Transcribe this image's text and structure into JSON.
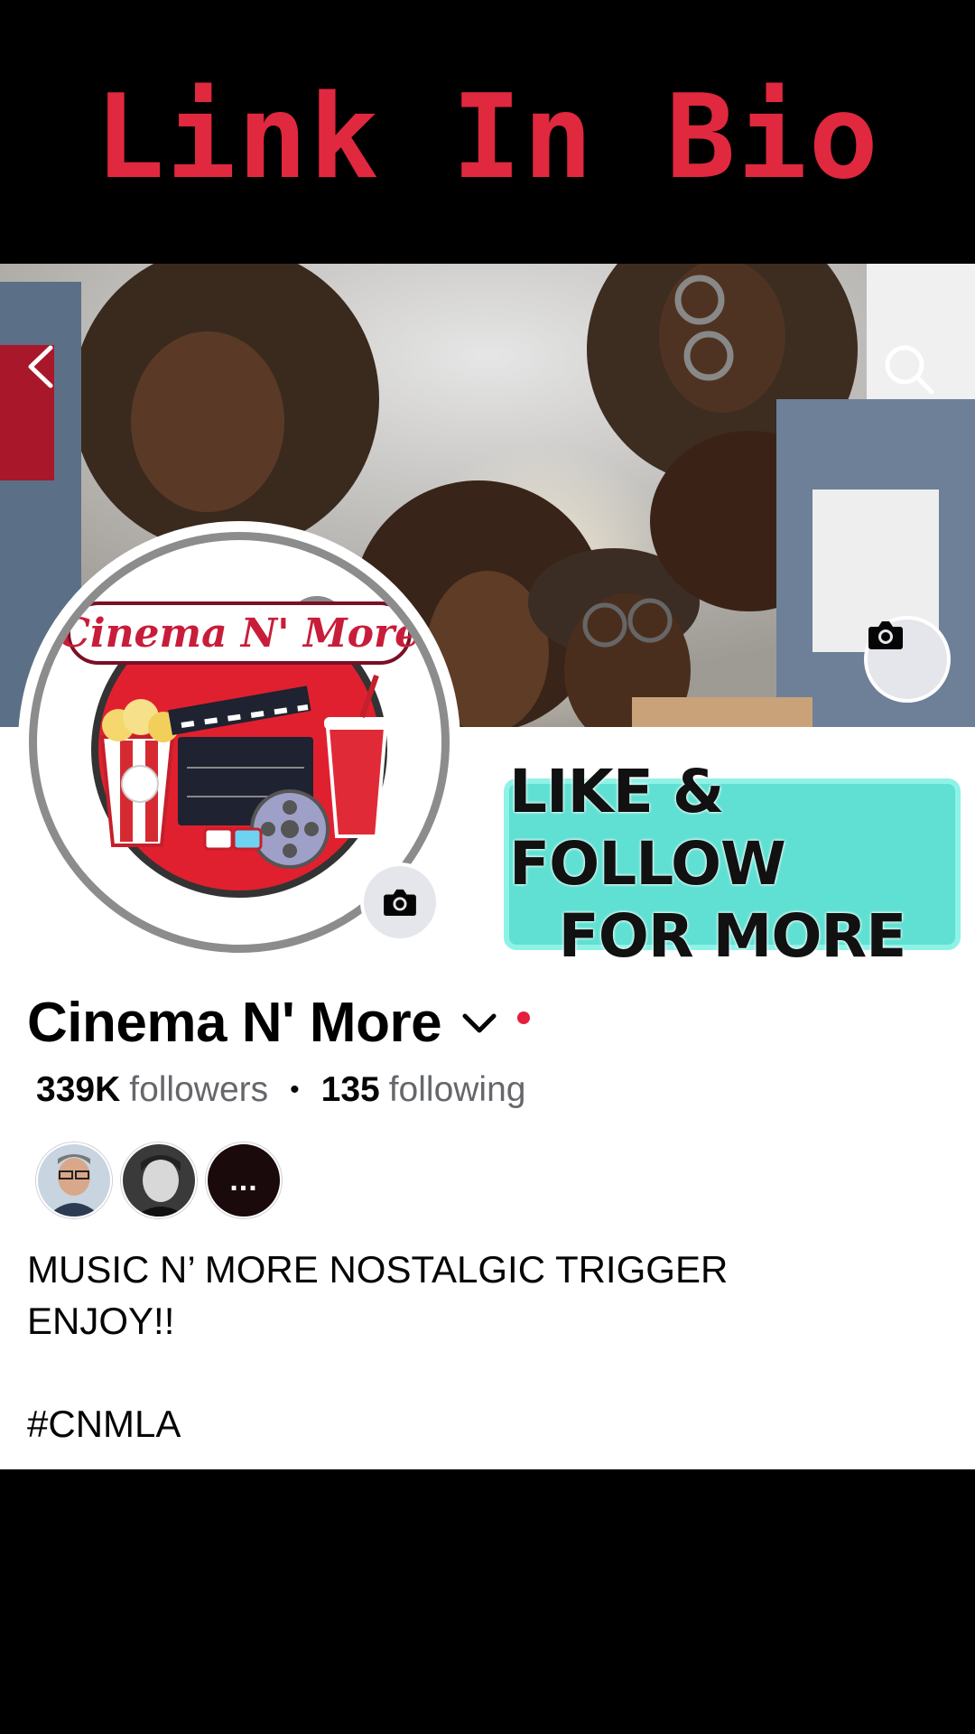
{
  "banner": {
    "title": "Link In Bio"
  },
  "header": {
    "back_icon": "chevron-left-icon",
    "search_icon": "search-icon"
  },
  "profile": {
    "name": "Cinema N' More",
    "logo_text": "Cinema N' More",
    "followers_count": "339K",
    "followers_label": "followers",
    "following_count": "135",
    "following_label": "following",
    "separator": "•"
  },
  "promo": {
    "line1": "LIKE & FOLLOW",
    "line2": "FOR MORE"
  },
  "friends": {
    "more_label": "..."
  },
  "bio": {
    "line1": "MUSIC N’ MORE NOSTALGIC TRIGGER",
    "line2": "ENJOY!!",
    "hashtag": "#CNMLA"
  },
  "colors": {
    "banner_text": "#e0283f",
    "promo_bg": "#5fe0d2",
    "status_dot": "#e41e3f",
    "secondary_text": "#65676b"
  }
}
